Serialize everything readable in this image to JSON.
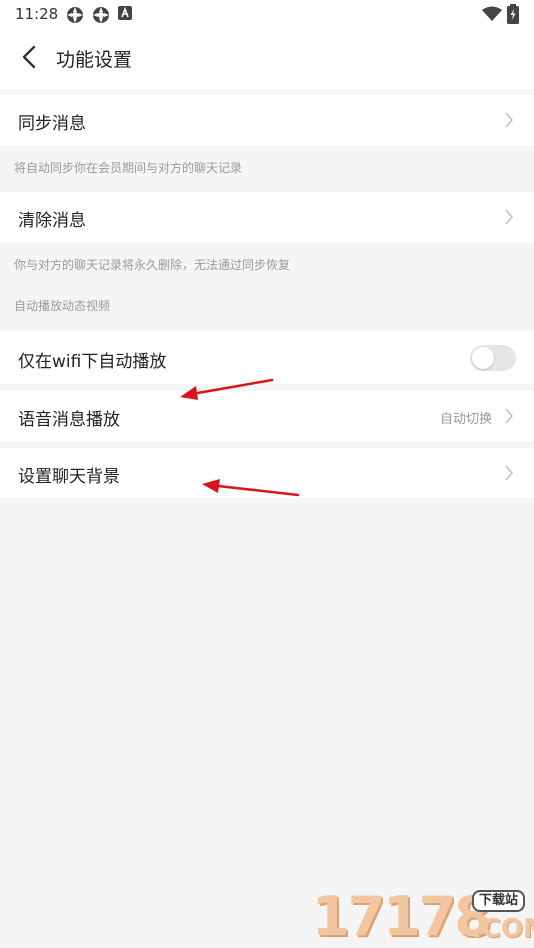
{
  "status_bar": {
    "time": "11:28",
    "icons": [
      "notification-icon",
      "notification-icon",
      "app-icon",
      "wifi-icon",
      "battery-icon"
    ]
  },
  "header": {
    "title": "功能设置",
    "back_icon": "chevron-left-icon"
  },
  "settings": {
    "sync": {
      "label": "同步消息",
      "note": "将自动同步你在会员期间与对方的聊天记录"
    },
    "clear": {
      "label": "清除消息",
      "note": "你与对方的聊天记录将永久删除，无法通过同步恢复"
    },
    "video_section_title": "自动播放动态视频",
    "wifi_autoplay": {
      "label": "仅在wifi下自动播放",
      "enabled": false
    },
    "voice_play": {
      "label": "语音消息播放",
      "value": "自动切换"
    },
    "chat_bg": {
      "label": "设置聊天背景"
    }
  },
  "annotation_color": "#d8141c",
  "watermark": {
    "number": "17178",
    "badge": "下载站",
    "suffix": ".COM"
  }
}
